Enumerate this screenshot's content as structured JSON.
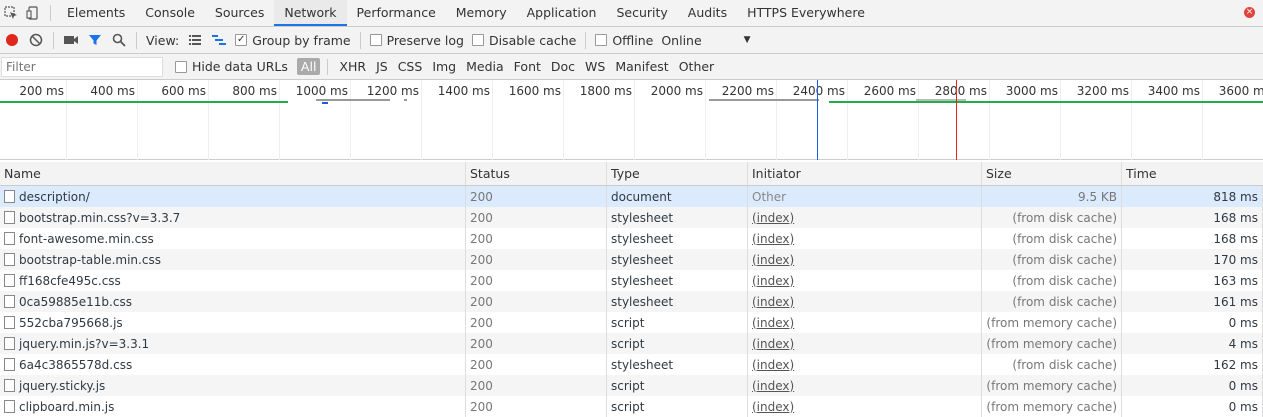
{
  "tabs": [
    "Elements",
    "Console",
    "Sources",
    "Network",
    "Performance",
    "Memory",
    "Application",
    "Security",
    "Audits",
    "HTTPS Everywhere"
  ],
  "active_tab": "Network",
  "toolbar": {
    "view_label": "View:",
    "group_by_frame": "Group by frame",
    "preserve_log": "Preserve log",
    "disable_cache": "Disable cache",
    "offline": "Offline",
    "throttle_value": "Online"
  },
  "filter": {
    "placeholder": "Filter",
    "hide_data_urls": "Hide data URLs",
    "types": [
      "All",
      "XHR",
      "JS",
      "CSS",
      "Img",
      "Media",
      "Font",
      "Doc",
      "WS",
      "Manifest",
      "Other"
    ],
    "active_type": "All"
  },
  "overview": {
    "ticks": [
      "200 ms",
      "400 ms",
      "600 ms",
      "800 ms",
      "1000 ms",
      "1200 ms",
      "1400 ms",
      "1600 ms",
      "1800 ms",
      "2000 ms",
      "2200 ms",
      "2400 ms",
      "2600 ms",
      "2800 ms",
      "3000 ms",
      "3200 ms",
      "3400 ms",
      "3600 ms"
    ],
    "dom_content_color": "#1a5ee8",
    "load_color": "#e0271b",
    "bar_green": "#1db04a"
  },
  "table": {
    "headers": [
      "Name",
      "Status",
      "Type",
      "Initiator",
      "Size",
      "Time"
    ],
    "rows": [
      {
        "name": "description/",
        "status": "200",
        "type": "document",
        "initiator": "Other",
        "size": "9.5 KB",
        "time": "818 ms"
      },
      {
        "name": "bootstrap.min.css?v=3.3.7",
        "status": "200",
        "type": "stylesheet",
        "initiator": "(index)",
        "size": "(from disk cache)",
        "time": "168 ms"
      },
      {
        "name": "font-awesome.min.css",
        "status": "200",
        "type": "stylesheet",
        "initiator": "(index)",
        "size": "(from disk cache)",
        "time": "168 ms"
      },
      {
        "name": "bootstrap-table.min.css",
        "status": "200",
        "type": "stylesheet",
        "initiator": "(index)",
        "size": "(from disk cache)",
        "time": "170 ms"
      },
      {
        "name": "ff168cfe495c.css",
        "status": "200",
        "type": "stylesheet",
        "initiator": "(index)",
        "size": "(from disk cache)",
        "time": "163 ms"
      },
      {
        "name": "0ca59885e11b.css",
        "status": "200",
        "type": "stylesheet",
        "initiator": "(index)",
        "size": "(from disk cache)",
        "time": "161 ms"
      },
      {
        "name": "552cba795668.js",
        "status": "200",
        "type": "script",
        "initiator": "(index)",
        "size": "(from memory cache)",
        "time": "0 ms"
      },
      {
        "name": "jquery.min.js?v=3.3.1",
        "status": "200",
        "type": "script",
        "initiator": "(index)",
        "size": "(from memory cache)",
        "time": "4 ms"
      },
      {
        "name": "6a4c3865578d.css",
        "status": "200",
        "type": "stylesheet",
        "initiator": "(index)",
        "size": "(from disk cache)",
        "time": "162 ms"
      },
      {
        "name": "jquery.sticky.js",
        "status": "200",
        "type": "script",
        "initiator": "(index)",
        "size": "(from memory cache)",
        "time": "0 ms"
      },
      {
        "name": "clipboard.min.js",
        "status": "200",
        "type": "script",
        "initiator": "(index)",
        "size": "(from memory cache)",
        "time": "0 ms"
      }
    ]
  }
}
